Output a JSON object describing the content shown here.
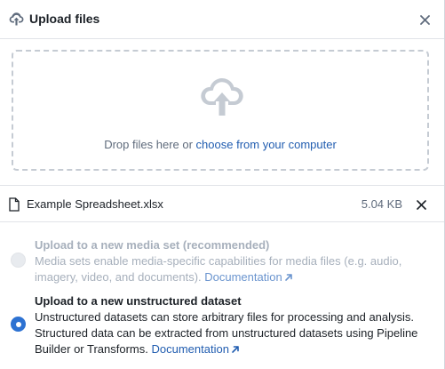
{
  "header": {
    "title": "Upload files",
    "upload_icon": "upload-icon",
    "close_icon": "close-icon"
  },
  "dropzone": {
    "text": "Drop files here or ",
    "link": "choose from your computer",
    "icon": "cloud-upload-icon"
  },
  "file": {
    "name": "Example Spreadsheet.xlsx",
    "size": "5.04 KB",
    "icon": "document-icon",
    "remove_icon": "close-icon"
  },
  "options": [
    {
      "title": "Upload to a new media set (recommended)",
      "description": "Media sets enable media-specific capabilities for media files (e.g. audio, imagery, video, and documents). ",
      "link": "Documentation",
      "selected": false,
      "disabled": true
    },
    {
      "title": "Upload to a new unstructured dataset",
      "description": "Unstructured datasets can store arbitrary files for processing and analysis. Structured data can be extracted from unstructured datasets using Pipeline Builder or Transforms. ",
      "link": "Documentation",
      "selected": true,
      "disabled": false
    }
  ],
  "colors": {
    "accent": "#2d72d2",
    "link": "#215db0",
    "muted": "#5f6b7c",
    "disabled": "#a7b0bc"
  }
}
